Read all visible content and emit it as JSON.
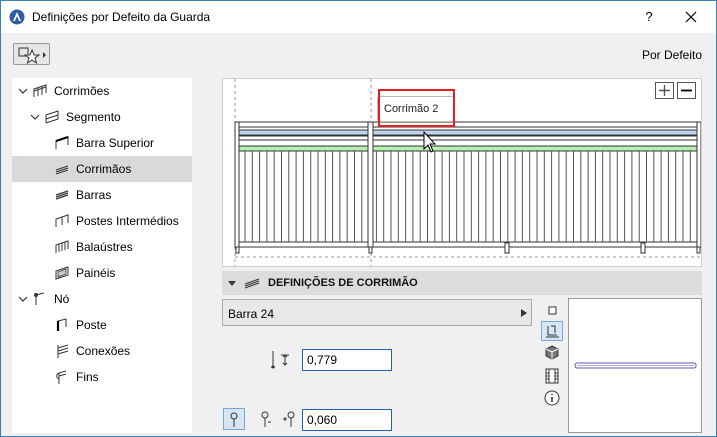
{
  "window": {
    "title": "Definições por Defeito da Guarda",
    "help_label": "?",
    "default_label": "Por Defeito"
  },
  "tree": {
    "items": [
      {
        "label": "Corrimões",
        "level": 0,
        "expanded": true
      },
      {
        "label": "Segmento",
        "level": 1,
        "expanded": true
      },
      {
        "label": "Barra Superior",
        "level": 2
      },
      {
        "label": "Corrimãos",
        "level": 2,
        "selected": true
      },
      {
        "label": "Barras",
        "level": 2
      },
      {
        "label": "Postes Intermédios",
        "level": 2
      },
      {
        "label": "Balaústres",
        "level": 2
      },
      {
        "label": "Painéis",
        "level": 2
      },
      {
        "label": "Nó",
        "level": 1,
        "expanded": true
      },
      {
        "label": "Poste",
        "level": 2
      },
      {
        "label": "Conexões",
        "level": 2
      },
      {
        "label": "Fins",
        "level": 2
      }
    ]
  },
  "preview": {
    "tooltip": "Corrimão 2",
    "zoom_in_label": "+",
    "zoom_out_label": "−"
  },
  "section": {
    "title": "DEFINIÇÕES DE CORRIMÃO"
  },
  "profile": {
    "value": "Barra 24"
  },
  "params": {
    "height": "0,779",
    "offset": "0,060"
  },
  "colors": {
    "accent": "#3c7fb1",
    "highlight_blue": "#bcd4f0",
    "highlight_green": "#b6f0b0",
    "red_outline": "#e02020"
  },
  "icons": {
    "favorites": "star-icon",
    "tooltip_cursor": "cursor-arrow-icon"
  }
}
